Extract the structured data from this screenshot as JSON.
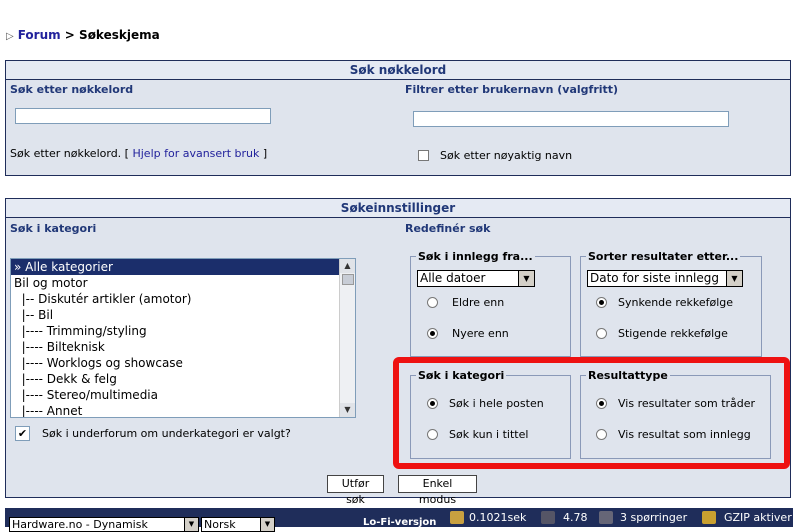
{
  "breadcrumb": {
    "arrow": "▷",
    "forum": "Forum",
    "separator": " > ",
    "current": "Søkeskjema"
  },
  "keyword_panel": {
    "title": "Søk nøkkelord",
    "keyword_label": "Søk etter nøkkelord",
    "username_label": "Filtrer etter brukernavn (valgfritt)",
    "keyword_value": "",
    "username_value": "",
    "help_prefix": "Søk etter nøkkelord. [",
    "help_link": "Hjelp for avansert bruk",
    "help_suffix": "]",
    "exact_name_label": "Søk etter nøyaktig navn",
    "exact_name_checked": false
  },
  "settings_panel": {
    "title": "Søkeinnstillinger",
    "category_label": "Søk i kategori",
    "refine_label": "Redefinér søk",
    "categories": [
      "» Alle kategorier",
      "Bil og motor",
      "  |-- Diskutér artikler (amotor)",
      "  |-- Bil",
      "  |---- Trimming/styling",
      "  |---- Bilteknisk",
      "  |---- Worklogs og showcase",
      "  |---- Dekk & felg",
      "  |---- Stereo/multimedia",
      "  |---- Annet"
    ],
    "selected_category": 0,
    "subforum_label": "Søk i underforum om underkategori er valgt?",
    "subforum_checked": true,
    "posts_from": {
      "legend": "Søk i innlegg fra...",
      "selected": "Alle datoer",
      "options": [
        {
          "label": "Eldre enn",
          "checked": false
        },
        {
          "label": "Nyere enn",
          "checked": true
        }
      ]
    },
    "sort": {
      "legend": "Sorter resultater etter...",
      "selected": "Dato for siste innlegg",
      "options": [
        {
          "label": "Synkende rekkefølge",
          "checked": true
        },
        {
          "label": "Stigende rekkefølge",
          "checked": false
        }
      ]
    },
    "search_in": {
      "legend": "Søk i kategori",
      "options": [
        {
          "label": "Søk i hele posten",
          "checked": true
        },
        {
          "label": "Søk kun i tittel",
          "checked": false
        }
      ]
    },
    "result_type": {
      "legend": "Resultattype",
      "options": [
        {
          "label": "Vis resultater som tråder",
          "checked": true
        },
        {
          "label": "Vis resultat som innlegg",
          "checked": false
        }
      ]
    }
  },
  "buttons": {
    "submit": "Utfør søk",
    "simple_mode": "Enkel modus"
  },
  "footer": {
    "style_select": "Hardware.no - Dynamisk",
    "language_select": "Norsk",
    "lofi": "Lo-Fi-versjon",
    "time": "0.1021sek",
    "load": "4.78",
    "queries": "3 spørringer",
    "gzip": "GZIP aktiver"
  },
  "colors": {
    "highlight": "#ee1111",
    "header_text": "#213878",
    "panel_bg": "#dfe4ed",
    "footer_bg": "#1f2d5a"
  }
}
